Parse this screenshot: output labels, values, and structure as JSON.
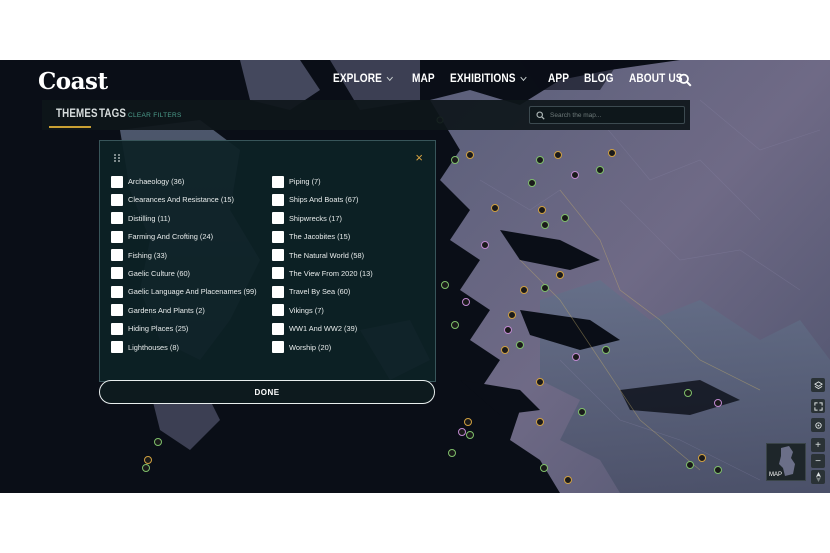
{
  "header": {
    "logo": "Coast",
    "nav": [
      {
        "label": "EXPLORE",
        "dropdown": true
      },
      {
        "label": "MAP",
        "dropdown": false
      },
      {
        "label": "EXHIBITIONS",
        "dropdown": true
      },
      {
        "label": "APP",
        "dropdown": false
      },
      {
        "label": "BLOG",
        "dropdown": false
      },
      {
        "label": "ABOUT US",
        "dropdown": false
      }
    ]
  },
  "filterbar": {
    "tab_themes": "THEMES",
    "tab_tags": "TAGS",
    "clear_filters": "CLEAR FILTERS",
    "search_placeholder": "Search the map..."
  },
  "modal": {
    "close_label": "×",
    "left_options": [
      "Archaeology (36)",
      "Clearances And Resistance (15)",
      "Distilling (11)",
      "Farming And Crofting (24)",
      "Fishing (33)",
      "Gaelic Culture (60)",
      "Gaelic Language And Placenames (99)",
      "Gardens And Plants (2)",
      "Hiding Places (25)",
      "Lighthouses (8)"
    ],
    "right_options": [
      "Piping (7)",
      "Ships And Boats (67)",
      "Shipwrecks (17)",
      "The Jacobites (15)",
      "The Natural World (58)",
      "The View From 2020 (13)",
      "Travel By Sea (60)",
      "Vikings (7)",
      "WW1 And WW2 (39)",
      "Worship (20)"
    ],
    "done_label": "DONE"
  },
  "map_controls": {
    "zoom_in": "+",
    "zoom_out": "−",
    "minimap_label": "MAP"
  },
  "colors": {
    "accent": "#c8a033",
    "link": "#4d9e8d",
    "panel": "#0d2126"
  }
}
